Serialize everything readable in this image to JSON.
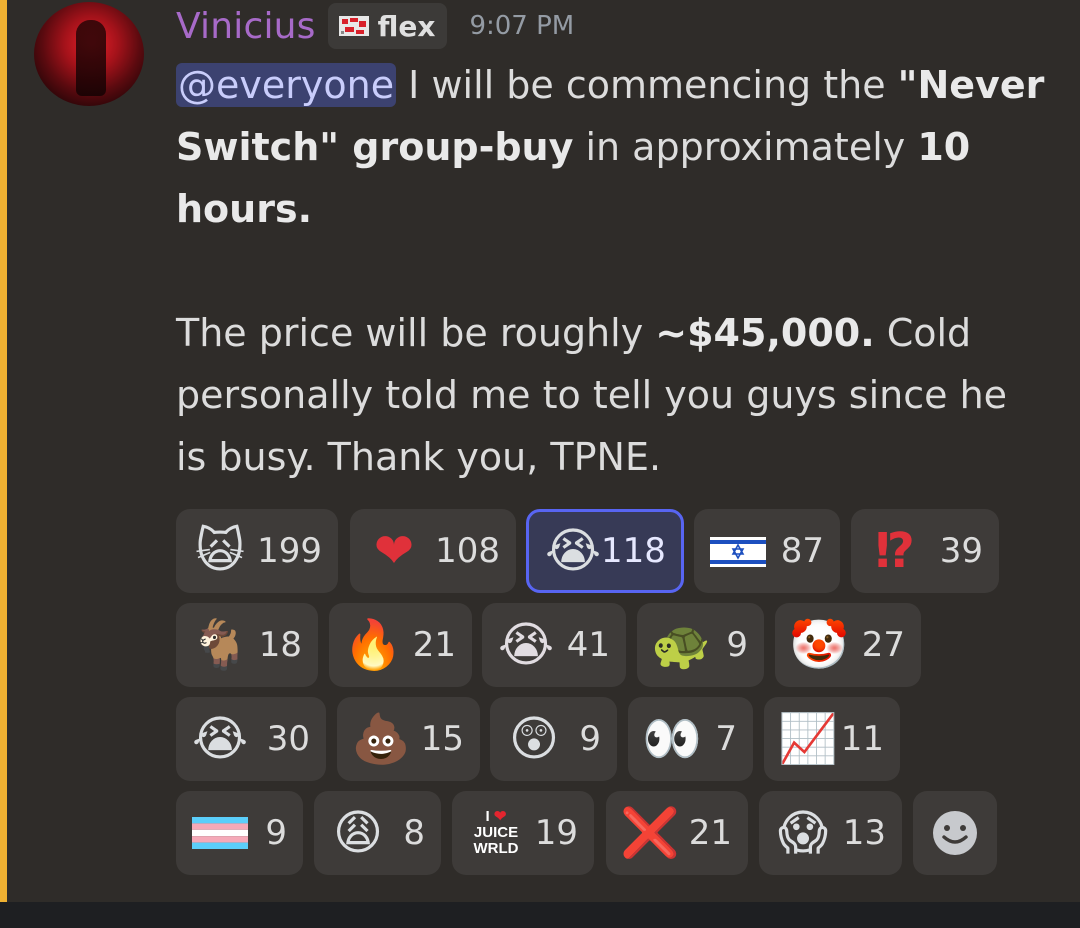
{
  "author": {
    "name": "Vinicius",
    "role_tag": "flex",
    "timestamp": "9:07 PM"
  },
  "message": {
    "mention": "@everyone",
    "line1_text": " I will be commencing the ",
    "line1_bold": "\"Never Switch\" group-buy",
    "line1_text2": " in approximately ",
    "line1_bold2": "10 hours.",
    "line2_text": "The price will be roughly ",
    "line2_bold": "~$45,000.",
    "line2_text2": " Cold personally told me to tell you guys since he is busy. Thank you, TPNE."
  },
  "reactions": [
    {
      "emoji": "scream-cat",
      "glyph": "🙀",
      "count": "199"
    },
    {
      "emoji": "red-heart",
      "glyph": "❤",
      "count": "108"
    },
    {
      "emoji": "loudly-crying-face",
      "glyph": "😭",
      "count": "118",
      "me": true
    },
    {
      "emoji": "flag-israel",
      "glyph": "",
      "count": "87"
    },
    {
      "emoji": "interrobang",
      "glyph": "⁉",
      "count": "39"
    },
    {
      "emoji": "goat",
      "glyph": "🐐",
      "count": "18"
    },
    {
      "emoji": "fire",
      "glyph": "🔥",
      "count": "21"
    },
    {
      "emoji": "green-crying-face",
      "glyph": "😭",
      "count": "41"
    },
    {
      "emoji": "turtle-custom",
      "glyph": "🐢",
      "count": "9"
    },
    {
      "emoji": "clown-face",
      "glyph": "🤡",
      "count": "27"
    },
    {
      "emoji": "crying-face",
      "glyph": "😭",
      "count": "30"
    },
    {
      "emoji": "pile-of-poo",
      "glyph": "💩",
      "count": "15"
    },
    {
      "emoji": "shocked-face-custom",
      "glyph": "😲",
      "count": "9"
    },
    {
      "emoji": "eyes",
      "glyph": "👀",
      "count": "7"
    },
    {
      "emoji": "chart-increasing",
      "glyph": "📈",
      "count": "11"
    },
    {
      "emoji": "transgender-flag",
      "glyph": "",
      "count": "9"
    },
    {
      "emoji": "weary-face",
      "glyph": "😩",
      "count": "8"
    },
    {
      "emoji": "juice-wrld",
      "glyph": "I ❤ JUICE WRLD",
      "count": "19"
    },
    {
      "emoji": "cross-mark",
      "glyph": "❌",
      "count": "21"
    },
    {
      "emoji": "screaming-custom",
      "glyph": "😱",
      "count": "13"
    }
  ],
  "colors": {
    "username": "#a76ac8",
    "mention_bg": "#3c4270",
    "mention_bar": "#f0b132",
    "reaction_active_border": "#5865f2"
  }
}
